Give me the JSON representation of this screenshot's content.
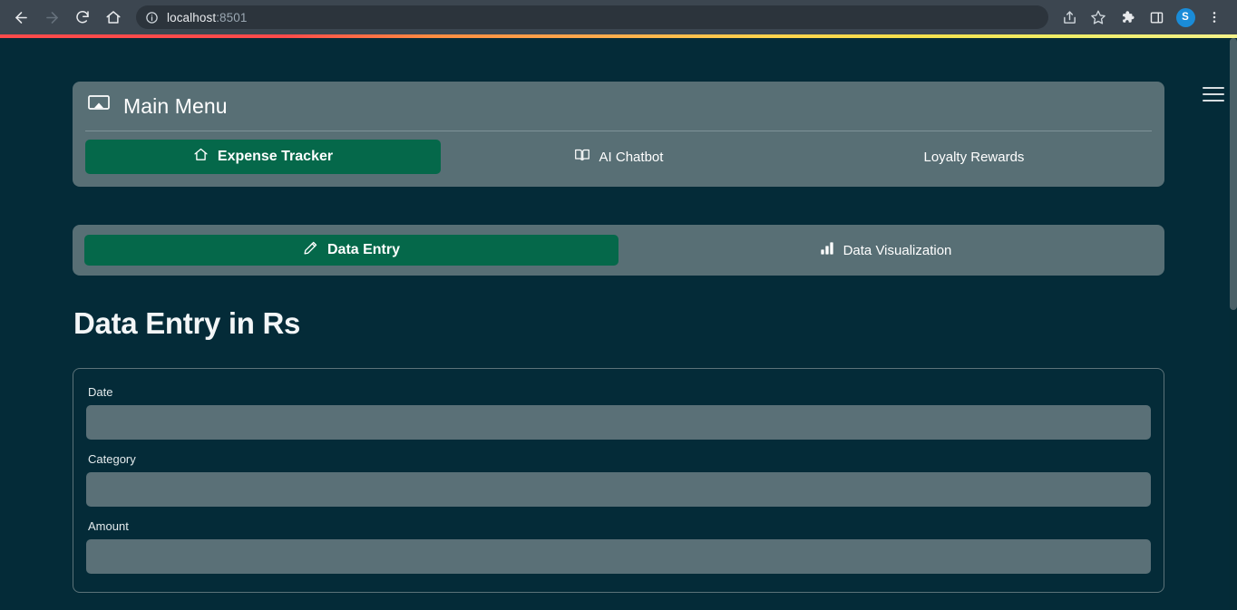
{
  "browser": {
    "back_label": "Back",
    "forward_label": "Forward",
    "reload_label": "Reload",
    "home_label": "Home",
    "site_info_label": "Site information",
    "url_host": "localhost",
    "url_port": ":8501",
    "share_label": "Share",
    "bookmark_label": "Bookmark this tab",
    "extensions_label": "Extensions",
    "side_panel_label": "Side panel",
    "profile_initial": "S",
    "menu_label": "Customize and control Chrome"
  },
  "app": {
    "hamburger_label": "Main menu",
    "main_menu": {
      "title": "Main Menu",
      "icon": "cast-icon",
      "tabs": [
        {
          "label": "Expense Tracker",
          "icon": "home-icon",
          "active": true
        },
        {
          "label": "AI Chatbot",
          "icon": "book-icon",
          "active": false
        },
        {
          "label": "Loyalty Rewards",
          "icon": "",
          "active": false
        }
      ]
    },
    "sub_nav": {
      "tabs": [
        {
          "label": "Data Entry",
          "icon": "pencil-icon",
          "active": true
        },
        {
          "label": "Data Visualization",
          "icon": "bar-chart-icon",
          "active": false
        }
      ]
    },
    "heading": "Data Entry in Rs",
    "form": {
      "fields": [
        {
          "label": "Date",
          "value": "",
          "placeholder": ""
        },
        {
          "label": "Category",
          "value": "",
          "placeholder": ""
        },
        {
          "label": "Amount",
          "value": "",
          "placeholder": ""
        }
      ]
    }
  },
  "colors": {
    "background": "#042b38",
    "panel": "#586f75",
    "accent_green": "#05684a",
    "input": "#5a7077",
    "browser_chrome": "#3c4650",
    "avatar": "#1a8cd8"
  }
}
